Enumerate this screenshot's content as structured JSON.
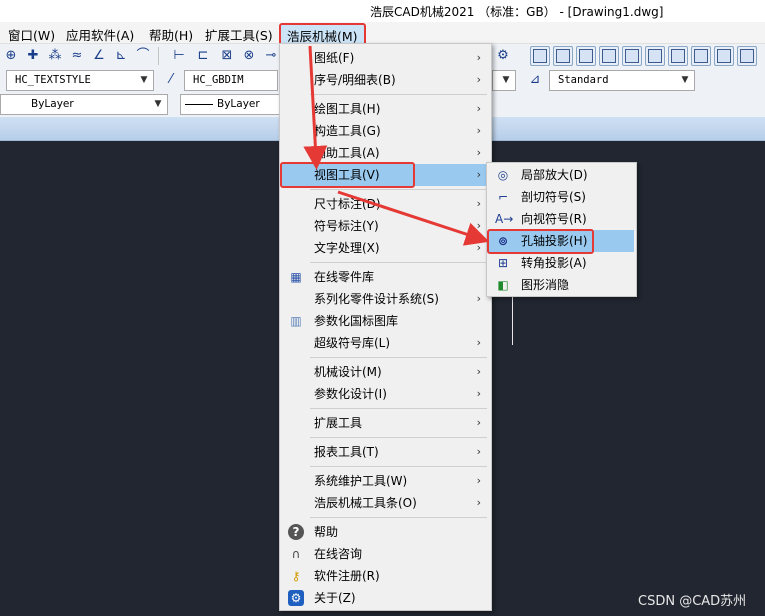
{
  "window": {
    "title": "浩辰CAD机械2021 （标准：GB） - [Drawing1.dwg]"
  },
  "menubar": {
    "items": [
      {
        "label": "窗口(W)"
      },
      {
        "label": "应用软件(A)"
      },
      {
        "label": "帮助(H)"
      },
      {
        "label": "扩展工具(S)"
      },
      {
        "label": "浩辰机械(M)"
      }
    ]
  },
  "toolbar": {
    "text_style": "HC_TEXTSTYLE",
    "dim_style": "HC_GBDIM",
    "standard": "Standard",
    "layer_color": "ByLayer",
    "linetype": "ByLayer"
  },
  "main_menu": {
    "items": [
      {
        "label": "图纸(F)"
      },
      {
        "label": "序号/明细表(B)"
      },
      {
        "label": "绘图工具(H)"
      },
      {
        "label": "构造工具(G)"
      },
      {
        "label": "辅助工具(A)"
      },
      {
        "label": "视图工具(V)"
      },
      {
        "label": "尺寸标注(D)"
      },
      {
        "label": "符号标注(Y)"
      },
      {
        "label": "文字处理(X)"
      },
      {
        "label": "在线零件库"
      },
      {
        "label": "系列化零件设计系统(S)"
      },
      {
        "label": "参数化国标图库"
      },
      {
        "label": "超级符号库(L)"
      },
      {
        "label": "机械设计(M)"
      },
      {
        "label": "参数化设计(I)"
      },
      {
        "label": "扩展工具"
      },
      {
        "label": "报表工具(T)"
      },
      {
        "label": "系统维护工具(W)"
      },
      {
        "label": "浩辰机械工具条(O)"
      },
      {
        "label": "帮助"
      },
      {
        "label": "在线咨询"
      },
      {
        "label": "软件注册(R)"
      },
      {
        "label": "关于(Z)"
      }
    ]
  },
  "sub_menu": {
    "items": [
      {
        "label": "局部放大(D)"
      },
      {
        "label": "剖切符号(S)"
      },
      {
        "label": "向视符号(R)"
      },
      {
        "label": "孔轴投影(H)"
      },
      {
        "label": "转角投影(A)"
      },
      {
        "label": "图形消隐"
      }
    ]
  },
  "watermark": "CSDN @CAD苏州",
  "colors": {
    "canvas": "#212630",
    "highlight": "#99c9ef",
    "annotation_red": "#e53935"
  }
}
